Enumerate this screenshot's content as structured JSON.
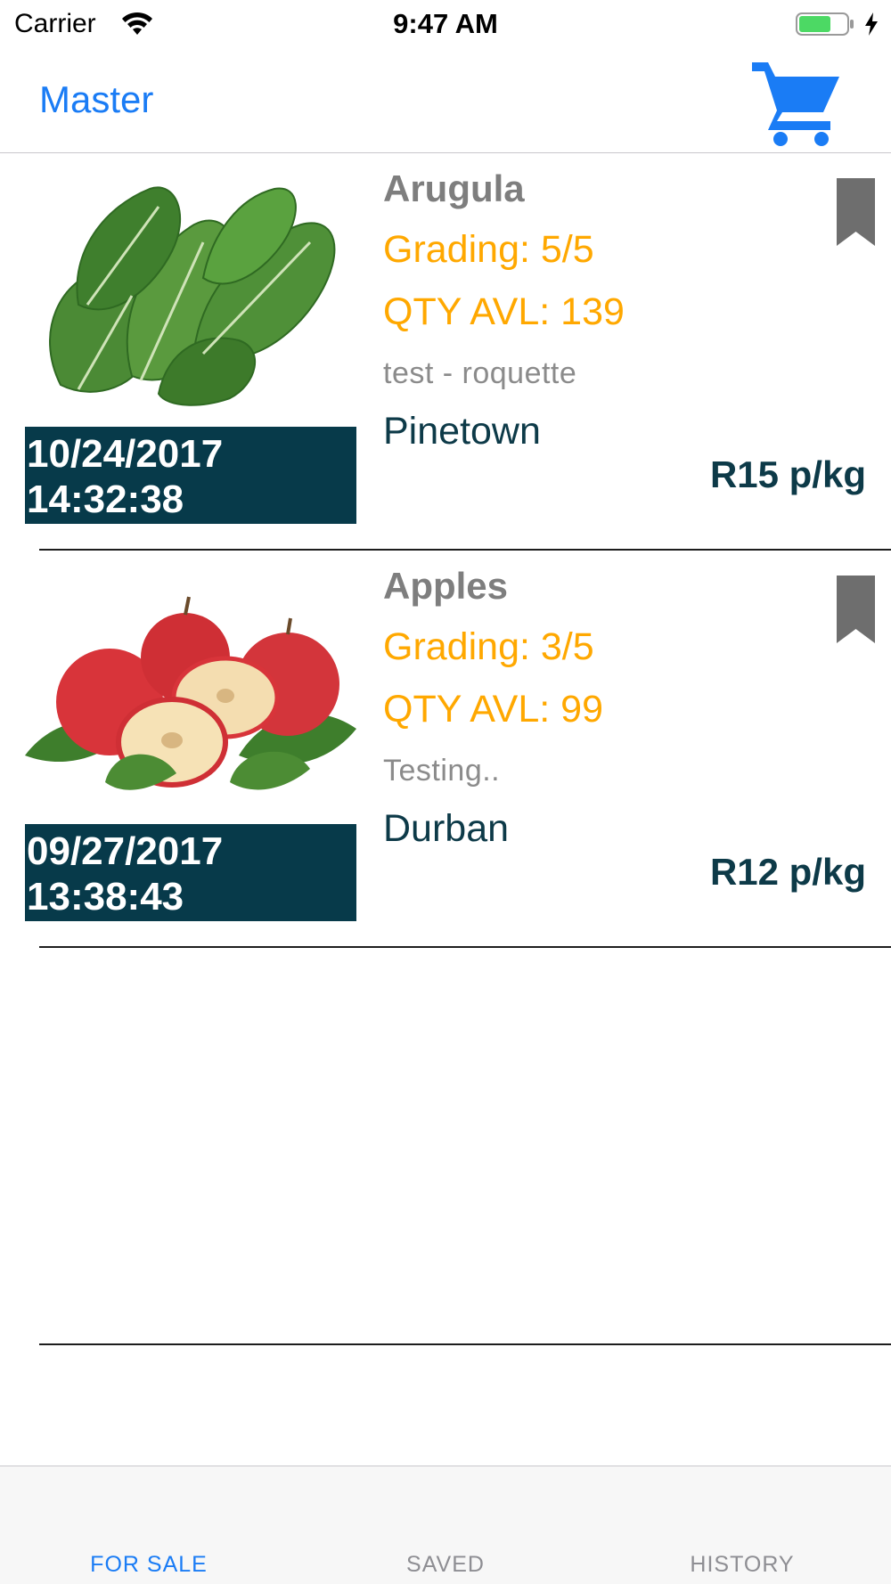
{
  "status_bar": {
    "carrier": "Carrier",
    "time": "9:47 AM",
    "icons": [
      "wifi-icon",
      "battery-icon",
      "charging-icon"
    ]
  },
  "nav": {
    "back_label": "Master",
    "right_icon": "cart-icon",
    "accent_color": "#1a7cf5"
  },
  "products": [
    {
      "name": "Arugula",
      "grading": "Grading: 5/5",
      "qty": "QTY AVL: 139",
      "description": "test - roquette",
      "location": "Pinetown",
      "price": "R15 p/kg",
      "date": "10/24/2017",
      "time": "14:32:38",
      "image": "arugula-image",
      "bookmark_icon": "bookmark-icon"
    },
    {
      "name": "Apples",
      "grading": "Grading: 3/5",
      "qty": "QTY AVL: 99",
      "description": "Testing..",
      "location": "Durban",
      "price": "R12 p/kg",
      "date": "09/27/2017",
      "time": "13:38:43",
      "image": "apples-image",
      "bookmark_icon": "bookmark-icon"
    }
  ],
  "tabs": [
    {
      "label": "FOR SALE",
      "active": true
    },
    {
      "label": "SAVED",
      "active": false
    },
    {
      "label": "HISTORY",
      "active": false
    }
  ],
  "colors": {
    "grading": "#ffa800",
    "stamp_bg": "#073a4a",
    "location": "#0d3a48",
    "tab_active": "#1a7cf5",
    "tab_inactive": "#8e8e93"
  }
}
